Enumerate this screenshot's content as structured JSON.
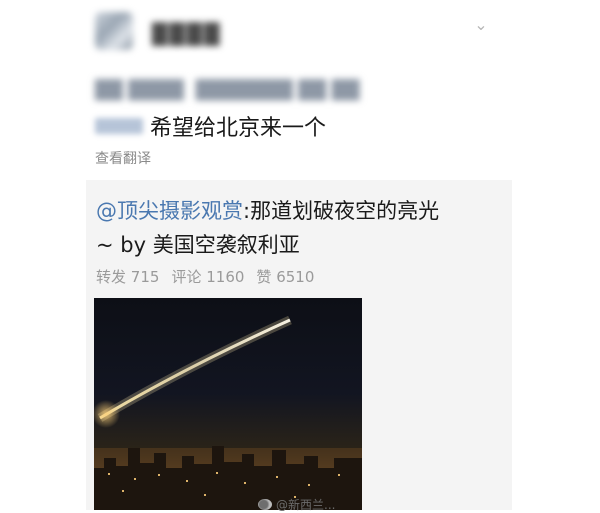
{
  "post": {
    "author_name": "████",
    "meta_text_1": "██ ████",
    "meta_text_2": "███████ ██ ██",
    "mention_blur": "",
    "text": "希望给北京来一个",
    "translate_label": "查看翻译",
    "menu_icon": "chevron-down-icon"
  },
  "repost": {
    "mention": "@顶尖摄影观赏",
    "text_rest": ":那道划破夜空的亮光",
    "text_line2": "~ by 美国空袭叙利亚",
    "stats": [
      {
        "label": "转发",
        "value": "715"
      },
      {
        "label": "评论",
        "value": "1160"
      },
      {
        "label": "赞",
        "value": "6510"
      }
    ],
    "image_alt": "night sky missile streak over city"
  },
  "watermark": {
    "text": "@新西兰...",
    "icon": "weibo-icon"
  },
  "colors": {
    "mention": "#4a78b0",
    "card_bg": "#f4f4f4",
    "muted": "#9a9a9a"
  }
}
